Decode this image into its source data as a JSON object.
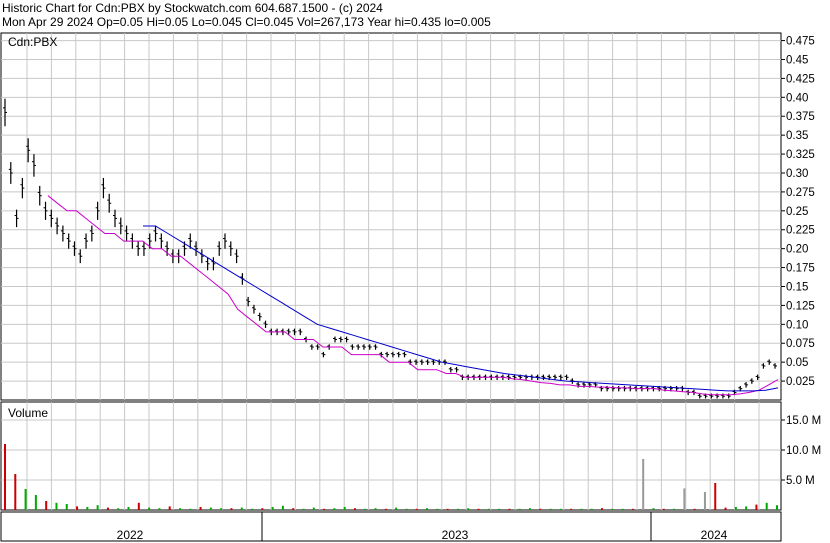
{
  "header": {
    "line1": "Historic Chart for Cdn:PBX by Stockwatch.com 604.687.1500 - (c) 2024",
    "line2": "Mon Apr 29 2024   Op=0.05   Hi=0.05   Lo=0.045   Cl=0.045   Vol=267,173   Year hi=0.435   lo=0.005"
  },
  "colors": {
    "price_bars": "#000000",
    "ma_short": "#cc00cc",
    "ma_long": "#0000cc",
    "volume_up": "#00aa00",
    "volume_down": "#cc0000",
    "volume_flat": "#999999",
    "grid": "#c8c8c8"
  },
  "chart_data": [
    {
      "type": "line",
      "panel": "price",
      "title": "Cdn:PBX",
      "y_ticks": [
        "0.475",
        "0.45",
        "0.425",
        "0.40",
        "0.375",
        "0.35",
        "0.325",
        "0.30",
        "0.275",
        "0.25",
        "0.225",
        "0.20",
        "0.175",
        "0.15",
        "0.125",
        "0.10",
        "0.075",
        "0.05",
        "0.025"
      ],
      "ylim": [
        0.0,
        0.485
      ],
      "x_labels": [
        "2022",
        "2023",
        "2024"
      ],
      "series": [
        {
          "style": "ohlc-bars",
          "values": [
            0.38,
            0.3,
            0.24,
            0.28,
            0.33,
            0.31,
            0.27,
            0.25,
            0.24,
            0.23,
            0.22,
            0.21,
            0.2,
            0.19,
            0.21,
            0.22,
            0.25,
            0.28,
            0.26,
            0.24,
            0.23,
            0.22,
            0.21,
            0.2,
            0.2,
            0.21,
            0.22,
            0.21,
            0.2,
            0.19,
            0.19,
            0.2,
            0.21,
            0.2,
            0.19,
            0.18,
            0.18,
            0.2,
            0.21,
            0.2,
            0.19,
            0.16,
            0.13,
            0.12,
            0.11,
            0.1,
            0.09,
            0.09,
            0.09,
            0.09,
            0.09,
            0.09,
            0.08,
            0.07,
            0.07,
            0.06,
            0.07,
            0.08,
            0.08,
            0.08,
            0.07,
            0.07,
            0.07,
            0.07,
            0.07,
            0.06,
            0.06,
            0.06,
            0.06,
            0.06,
            0.05,
            0.05,
            0.05,
            0.05,
            0.05,
            0.05,
            0.05,
            0.04,
            0.04,
            0.03,
            0.03,
            0.03,
            0.03,
            0.03,
            0.03,
            0.03,
            0.03,
            0.03,
            0.03,
            0.03,
            0.03,
            0.03,
            0.03,
            0.03,
            0.03,
            0.03,
            0.03,
            0.03,
            0.025,
            0.02,
            0.02,
            0.02,
            0.02,
            0.015,
            0.015,
            0.015,
            0.015,
            0.015,
            0.015,
            0.015,
            0.015,
            0.015,
            0.015,
            0.015,
            0.015,
            0.015,
            0.015,
            0.015,
            0.01,
            0.01,
            0.005,
            0.005,
            0.005,
            0.005,
            0.005,
            0.005,
            0.01,
            0.015,
            0.02,
            0.025,
            0.03,
            0.045,
            0.05,
            0.045
          ]
        },
        {
          "style": "moving-average-short",
          "values": [
            0.27,
            0.26,
            0.25,
            0.25,
            0.24,
            0.23,
            0.22,
            0.22,
            0.21,
            0.21,
            0.21,
            0.2,
            0.2,
            0.19,
            0.19,
            0.18,
            0.17,
            0.16,
            0.15,
            0.14,
            0.12,
            0.11,
            0.1,
            0.09,
            0.09,
            0.09,
            0.08,
            0.08,
            0.08,
            0.07,
            0.07,
            0.07,
            0.06,
            0.06,
            0.06,
            0.06,
            0.05,
            0.05,
            0.05,
            0.04,
            0.04,
            0.04,
            0.035,
            0.035,
            0.03,
            0.03,
            0.03,
            0.03,
            0.03,
            0.028,
            0.027,
            0.025,
            0.023,
            0.022,
            0.02,
            0.02,
            0.018,
            0.018,
            0.017,
            0.017,
            0.016,
            0.016,
            0.015,
            0.015,
            0.015,
            0.013,
            0.012,
            0.011,
            0.01,
            0.008,
            0.007,
            0.007,
            0.007,
            0.008,
            0.01,
            0.013,
            0.02,
            0.027
          ]
        },
        {
          "style": "moving-average-long",
          "values": [
            0.23,
            0.23,
            0.22,
            0.21,
            0.2,
            0.19,
            0.18,
            0.17,
            0.16,
            0.15,
            0.14,
            0.13,
            0.12,
            0.11,
            0.1,
            0.095,
            0.09,
            0.085,
            0.08,
            0.075,
            0.07,
            0.065,
            0.06,
            0.055,
            0.05,
            0.047,
            0.044,
            0.041,
            0.038,
            0.035,
            0.033,
            0.031,
            0.029,
            0.027,
            0.025,
            0.024,
            0.023,
            0.022,
            0.021,
            0.02,
            0.019,
            0.018,
            0.017,
            0.016,
            0.015,
            0.014,
            0.013,
            0.012,
            0.012,
            0.012,
            0.013,
            0.016
          ]
        }
      ]
    },
    {
      "type": "bar",
      "panel": "volume",
      "title": "Volume",
      "y_ticks": [
        "15.0 M",
        "10.0 M",
        "5.0 M"
      ],
      "ylim": [
        0,
        18.0
      ],
      "x_labels": [
        "2022",
        "2023",
        "2024"
      ],
      "values": [
        11.0,
        6.0,
        3.5,
        2.5,
        1.5,
        1.2,
        1.0,
        0.6,
        0.5,
        0.8,
        0.4,
        0.3,
        0.5,
        1.2,
        0.4,
        0.3,
        0.6,
        0.3,
        0.2,
        0.5,
        0.4,
        0.3,
        0.3,
        0.4,
        0.2,
        0.3,
        0.5,
        0.7,
        0.3,
        0.2,
        0.4,
        0.2,
        0.3,
        0.5,
        0.3,
        0.2,
        0.3,
        0.2,
        0.4,
        0.2,
        0.2,
        0.3,
        0.2,
        0.2,
        0.2,
        0.3,
        0.2,
        0.2,
        0.2,
        0.2,
        0.2,
        0.3,
        0.2,
        0.2,
        0.2,
        0.2,
        0.2,
        0.2,
        0.3,
        0.2,
        0.2,
        0.2,
        8.5,
        0.3,
        0.2,
        0.2,
        3.6,
        0.2,
        3.0,
        4.5,
        0.4,
        0.5,
        0.6,
        0.9,
        1.2,
        0.8
      ]
    }
  ]
}
